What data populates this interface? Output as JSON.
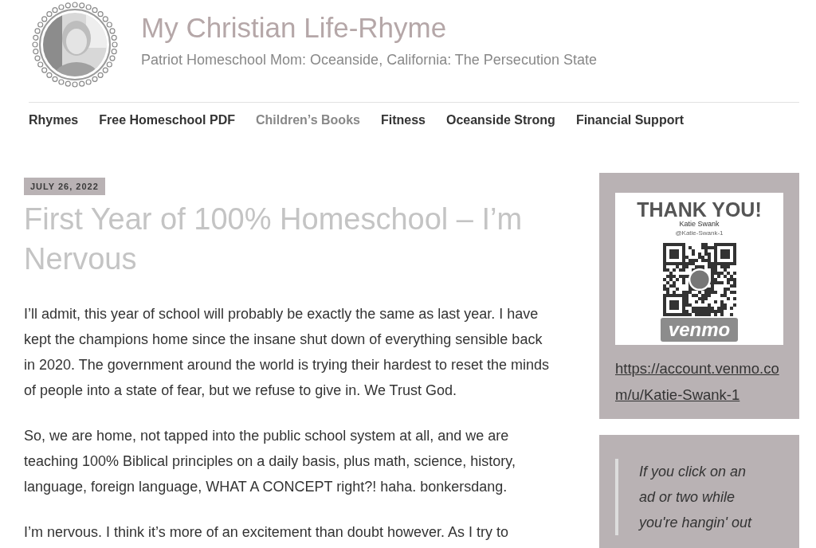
{
  "site": {
    "title": "My Christian Life-Rhyme",
    "tagline": "Patriot Homeschool Mom: Oceanside, California: The Persecution State"
  },
  "nav": [
    {
      "label": "Rhymes",
      "selected": false
    },
    {
      "label": "Free Homeschool PDF",
      "selected": false
    },
    {
      "label": "Children’s Books",
      "selected": true
    },
    {
      "label": "Fitness",
      "selected": false
    },
    {
      "label": "Oceanside Strong",
      "selected": false
    },
    {
      "label": "Financial Support",
      "selected": false
    }
  ],
  "post": {
    "date": "JULY 26, 2022",
    "title": "First Year of 100% Homeschool – I’m Nervous",
    "paragraphs": [
      "I’ll admit, this year of school will probably be exactly the same as last year. I have kept the champions home since the insane shut down of everything sensible back in 2020. The government around the world is trying their hardest to reset the minds of people into a state of fear, but we refuse to give in. We Trust God.",
      "So, we are home, not tapped into the public school system at all, and we are teaching 100% Biblical principles on a daily basis, plus math, science, history, language, foreign language, WHAT A CONCEPT right?! haha. bonkersdang.",
      "I’m nervous. I think it’s more of an excitement than doubt however. As I try to"
    ]
  },
  "sidebar": {
    "venmo_card": {
      "heading": "THANK YOU!",
      "name": "Katie Swank",
      "handle": "@Katie-Swank-1",
      "logo": "venmo"
    },
    "link": "https://account.venmo.com/u/Katie-Swank-1",
    "quote": "If you click on an ad or two while you're hangin' out"
  }
}
